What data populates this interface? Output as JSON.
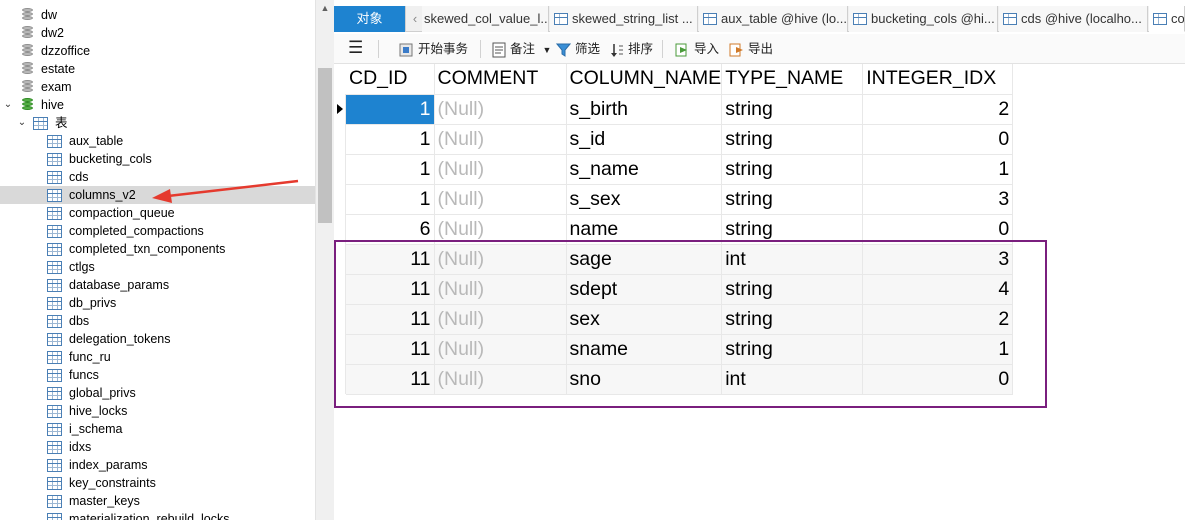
{
  "tree": {
    "databases_top": [
      "dw",
      "dw2",
      "dzzoffice",
      "estate",
      "exam"
    ],
    "hive": {
      "label": "hive",
      "tables_folder": "表"
    },
    "tables": [
      "aux_table",
      "bucketing_cols",
      "cds",
      "columns_v2",
      "compaction_queue",
      "completed_compactions",
      "completed_txn_components",
      "ctlgs",
      "database_params",
      "db_privs",
      "dbs",
      "delegation_tokens",
      "func_ru",
      "funcs",
      "global_privs",
      "hive_locks",
      "i_schema",
      "idxs",
      "index_params",
      "key_constraints",
      "master_keys",
      "materialization_rebuild_locks"
    ],
    "selected": "columns_v2"
  },
  "tabs": {
    "objects": "对象",
    "items": [
      "skewed_col_value_l...",
      "skewed_string_list ...",
      "aux_table @hive (lo...",
      "bucketing_cols @hi...",
      "cds @hive (localho...",
      "co"
    ]
  },
  "toolbar": {
    "begin_txn": "开始事务",
    "memo": "备注",
    "filter": "筛选",
    "sort": "排序",
    "import": "导入",
    "export": "导出"
  },
  "grid": {
    "columns": [
      "CD_ID",
      "COMMENT",
      "COLUMN_NAME",
      "TYPE_NAME",
      "INTEGER_IDX"
    ],
    "rows": [
      [
        "1",
        "(Null)",
        "s_birth",
        "string",
        "2"
      ],
      [
        "1",
        "(Null)",
        "s_id",
        "string",
        "0"
      ],
      [
        "1",
        "(Null)",
        "s_name",
        "string",
        "1"
      ],
      [
        "1",
        "(Null)",
        "s_sex",
        "string",
        "3"
      ],
      [
        "6",
        "(Null)",
        "name",
        "string",
        "0"
      ],
      [
        "11",
        "(Null)",
        "sage",
        "int",
        "3"
      ],
      [
        "11",
        "(Null)",
        "sdept",
        "string",
        "4"
      ],
      [
        "11",
        "(Null)",
        "sex",
        "string",
        "2"
      ],
      [
        "11",
        "(Null)",
        "sname",
        "string",
        "1"
      ],
      [
        "11",
        "(Null)",
        "sno",
        "int",
        "0"
      ]
    ]
  },
  "colors": {
    "accent": "#1e83d0",
    "highlight_box": "#7a1f7e",
    "arrow": "#e53a2e"
  }
}
